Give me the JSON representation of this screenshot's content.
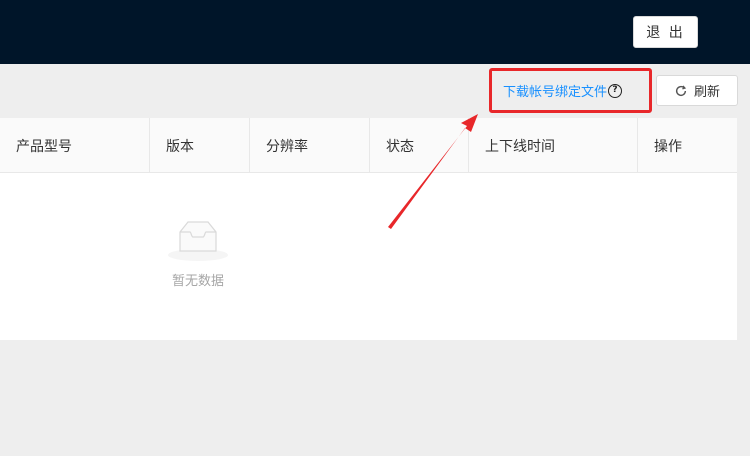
{
  "header": {
    "logout_label": "退 出"
  },
  "toolbar": {
    "download_label": "下载帐号绑定文件",
    "help_icon": "?",
    "refresh_label": "刷新"
  },
  "table": {
    "columns": [
      "产品型号",
      "版本",
      "分辨率",
      "状态",
      "上下线时间",
      "操作"
    ],
    "empty_text": "暂无数据"
  },
  "colors": {
    "topbar": "#001529",
    "link": "#1890ff",
    "annotation": "#e8272a"
  }
}
